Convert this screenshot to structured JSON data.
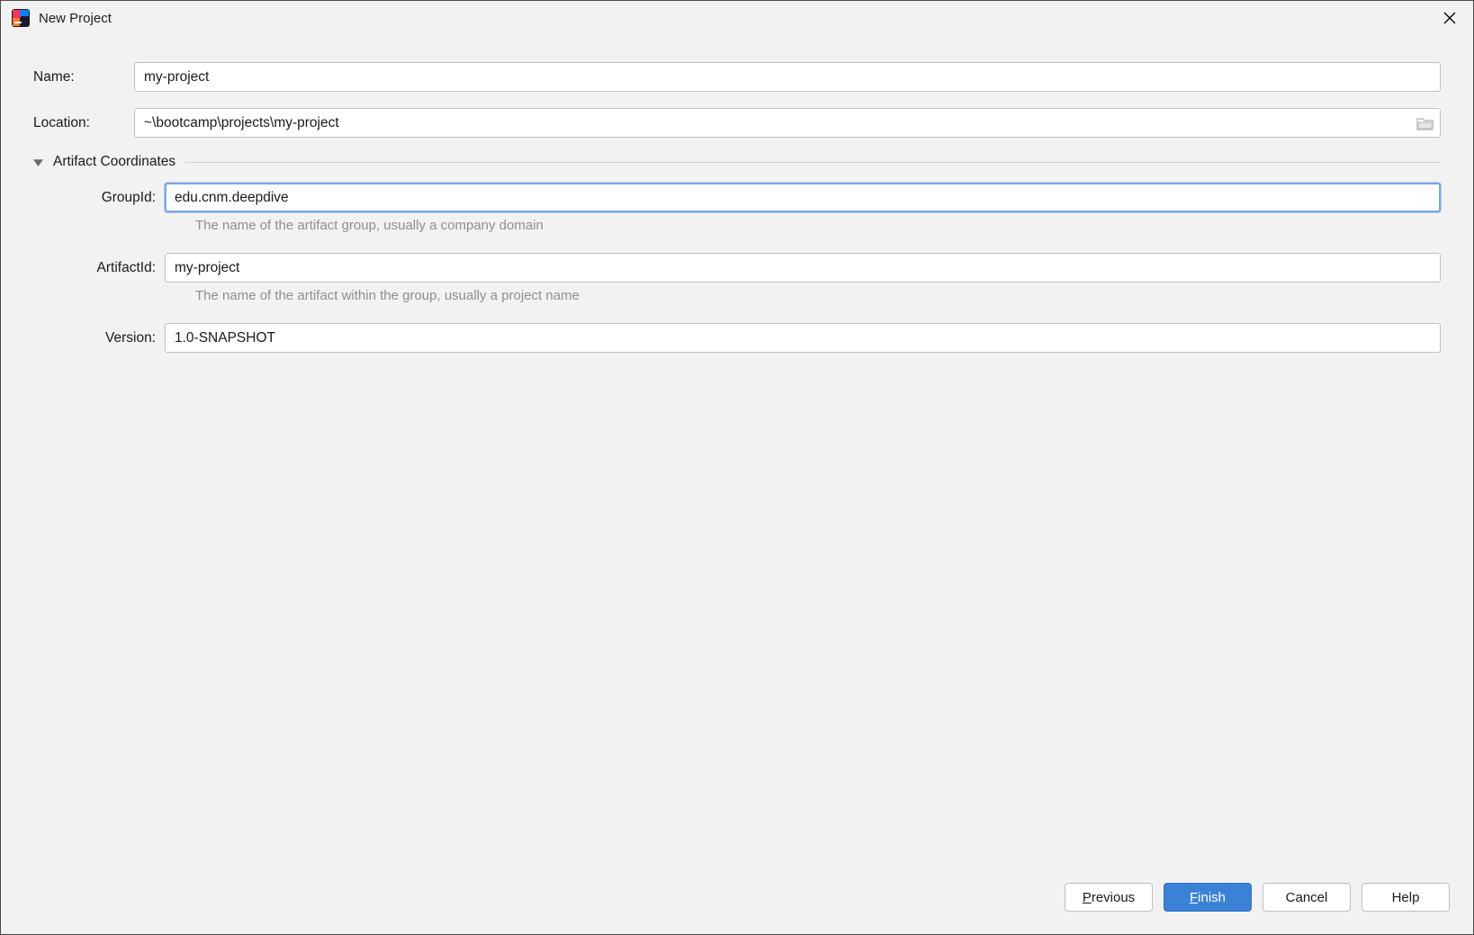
{
  "window": {
    "title": "New Project"
  },
  "fields": {
    "name_label": "Name:",
    "name_value": "my-project",
    "location_label": "Location:",
    "location_value": "~\\bootcamp\\projects\\my-project"
  },
  "section": {
    "title": "Artifact Coordinates",
    "expanded": true
  },
  "coords": {
    "groupid_label": "GroupId:",
    "groupid_value": "edu.cnm.deepdive",
    "groupid_hint": "The name of the artifact group, usually a company domain",
    "artifactid_label": "ArtifactId:",
    "artifactid_value": "my-project",
    "artifactid_hint": "The name of the artifact within the group, usually a project name",
    "version_label": "Version:",
    "version_value": "1.0-SNAPSHOT"
  },
  "buttons": {
    "previous": "revious",
    "previous_mn": "P",
    "finish": "inish",
    "finish_mn": "F",
    "cancel": "Cancel",
    "help": "Help"
  }
}
